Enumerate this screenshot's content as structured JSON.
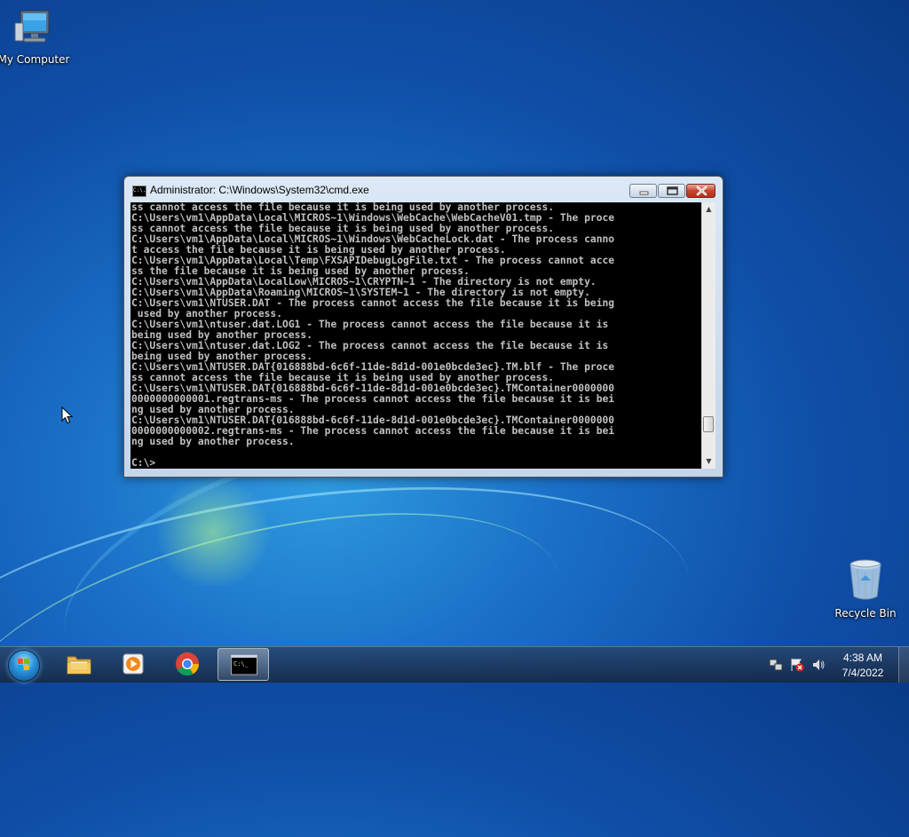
{
  "desktop": {
    "icons": [
      {
        "label": "My Computer",
        "icon": "computer-icon"
      },
      {
        "label": "Recycle Bin",
        "icon": "recycle-bin-icon"
      }
    ]
  },
  "cmd_window": {
    "title": "Administrator: C:\\Windows\\System32\\cmd.exe",
    "title_icon_text": "C:\\.",
    "lines": [
      "ss cannot access the file because it is being used by another process.",
      "C:\\Users\\vm1\\AppData\\Local\\MICROS~1\\Windows\\WebCache\\WebCacheV01.tmp - The proce",
      "ss cannot access the file because it is being used by another process.",
      "C:\\Users\\vm1\\AppData\\Local\\MICROS~1\\Windows\\WebCacheLock.dat - The process canno",
      "t access the file because it is being used by another process.",
      "C:\\Users\\vm1\\AppData\\Local\\Temp\\FXSAPIDebugLogFile.txt - The process cannot acce",
      "ss the file because it is being used by another process.",
      "C:\\Users\\vm1\\AppData\\LocalLow\\MICROS~1\\CRYPTN~1 - The directory is not empty.",
      "C:\\Users\\vm1\\AppData\\Roaming\\MICROS~1\\SYSTEM~1 - The directory is not empty.",
      "C:\\Users\\vm1\\NTUSER.DAT - The process cannot access the file because it is being",
      " used by another process.",
      "C:\\Users\\vm1\\ntuser.dat.LOG1 - The process cannot access the file because it is",
      "being used by another process.",
      "C:\\Users\\vm1\\ntuser.dat.LOG2 - The process cannot access the file because it is",
      "being used by another process.",
      "C:\\Users\\vm1\\NTUSER.DAT{016888bd-6c6f-11de-8d1d-001e0bcde3ec}.TM.blf - The proce",
      "ss cannot access the file because it is being used by another process.",
      "C:\\Users\\vm1\\NTUSER.DAT{016888bd-6c6f-11de-8d1d-001e0bcde3ec}.TMContainer0000000",
      "0000000000001.regtrans-ms - The process cannot access the file because it is bei",
      "ng used by another process.",
      "C:\\Users\\vm1\\NTUSER.DAT{016888bd-6c6f-11de-8d1d-001e0bcde3ec}.TMContainer0000000",
      "0000000000002.regtrans-ms - The process cannot access the file because it is bei",
      "ng used by another process.",
      "",
      "C:\\>"
    ],
    "scroll_position": 0.9
  },
  "taskbar": {
    "pinned": [
      {
        "name": "Windows Explorer",
        "icon": "folder-icon"
      },
      {
        "name": "Windows Media Player",
        "icon": "media-player-icon"
      },
      {
        "name": "Google Chrome",
        "icon": "chrome-icon"
      },
      {
        "name": "Command Prompt",
        "icon": "cmd-icon",
        "active": true
      }
    ],
    "cmd_icon_text": "C:\\_",
    "tray": [
      "network-icon",
      "action-center-icon",
      "volume-icon"
    ],
    "clock": {
      "time": "4:38 AM",
      "date": "7/4/2022"
    }
  },
  "colors": {
    "console_bg": "#000000",
    "console_fg": "#c0c0c0",
    "close_button": "#c8442e"
  }
}
